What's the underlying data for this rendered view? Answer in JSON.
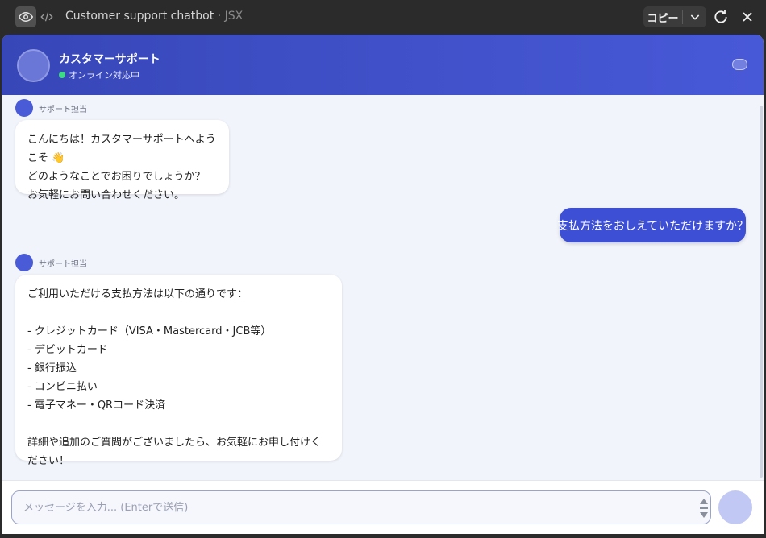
{
  "topbar": {
    "title": "Customer support chatbot",
    "separator": " · ",
    "file_type": "JSX",
    "copy_label": "コピー"
  },
  "chat_header": {
    "name": "カスタマーサポート",
    "status": "オンライン対応中"
  },
  "messages": [
    {
      "role": "bot",
      "sender": "サポート担当",
      "text": "こんにちは！カスタマーサポートへようこそ 👋\nどのようなことでお困りでしょうか？\nお気軽にお問い合わせください。"
    },
    {
      "role": "user",
      "text": "支払方法をおしえていただけますか？"
    },
    {
      "role": "bot",
      "sender": "サポート担当",
      "text": "ご利用いただける支払方法は以下の通りです：\n\n- クレジットカード（VISA・Mastercard・JCB等）\n- デビットカード\n- 銀行振込\n- コンビニ払い\n- 電子マネー・QRコード決済\n\n詳細や追加のご質問がございましたら、お気軽にお申し付けください！"
    }
  ],
  "input": {
    "placeholder": "メッセージを入力... (Enterで送信)",
    "value": ""
  },
  "colors": {
    "header_gradient_start": "#3747b8",
    "header_gradient_end": "#4859d8",
    "user_bubble": "#3d4fd4",
    "online_dot": "#3ddc84",
    "send_button": "#c2c8f4"
  }
}
